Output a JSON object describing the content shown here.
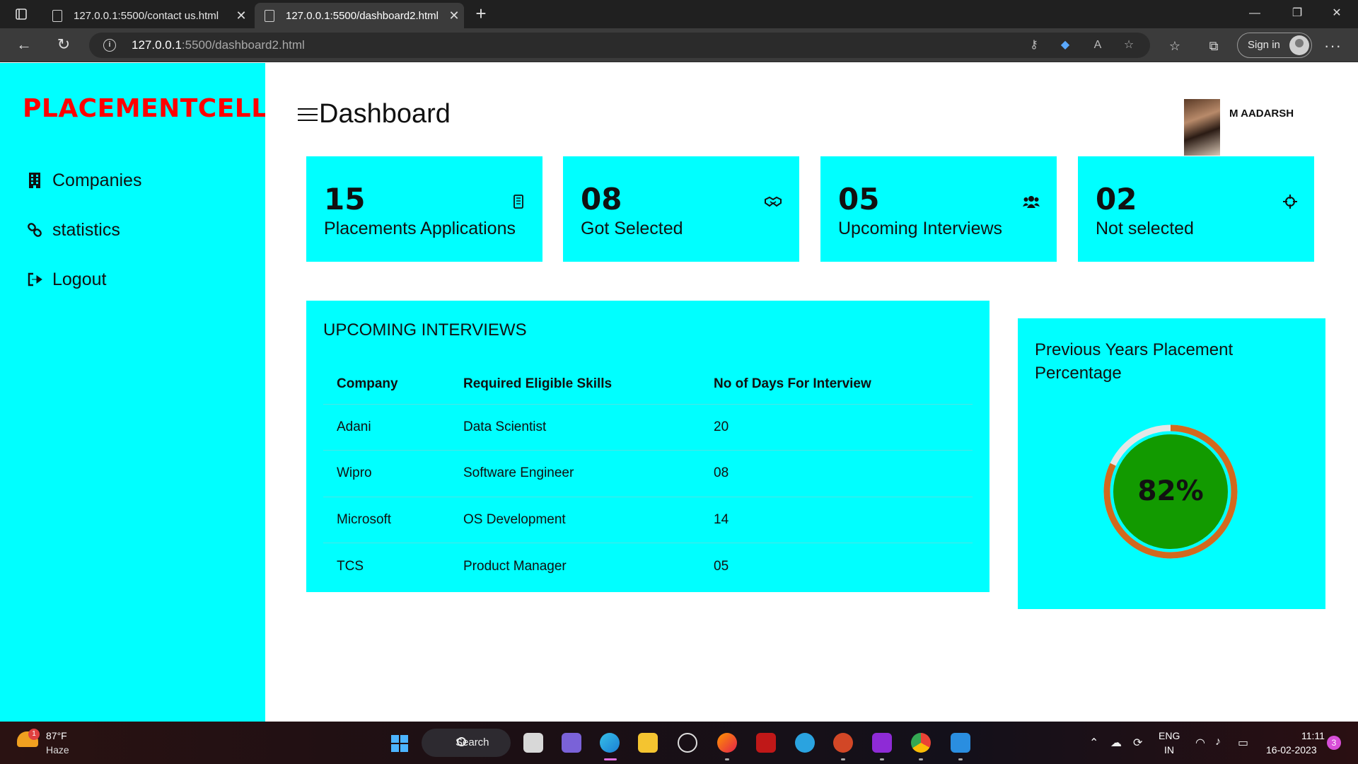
{
  "browser": {
    "tabs": [
      {
        "title": "127.0.0.1:5500/contact us.html",
        "active": false
      },
      {
        "title": "127.0.0.1:5500/dashboard2.html",
        "active": true
      }
    ],
    "url_host": "127.0.0.1",
    "url_rest": ":5500/dashboard2.html",
    "sign_in_label": "Sign in",
    "more_label": "···",
    "new_tab_label": "+",
    "minimize_label": "—",
    "restore_label": "❐",
    "close_label": "✕"
  },
  "sidebar": {
    "brand": "PLACEMENTCELL",
    "items": [
      {
        "label": "Companies",
        "icon": "building-icon"
      },
      {
        "label": "statistics",
        "icon": "link-icon"
      },
      {
        "label": "Logout",
        "icon": "logout-icon"
      }
    ]
  },
  "header": {
    "title": "Dashboard",
    "user_name": "M AADARSH"
  },
  "cards": [
    {
      "number": "15",
      "label": "Placements Applications",
      "icon": "phone-icon",
      "glyph": "▯"
    },
    {
      "number": "08",
      "label": "Got Selected",
      "icon": "handshake-icon",
      "glyph": "🤝"
    },
    {
      "number": "05",
      "label": "Upcoming Interviews",
      "icon": "users-icon",
      "glyph": "👥"
    },
    {
      "number": "02",
      "label": "Not selected",
      "icon": "crosshair-icon",
      "glyph": "⌖"
    }
  ],
  "interviews": {
    "title": "UPCOMING INTERVIEWS",
    "columns": [
      "Company",
      "Required Eligible Skills",
      "No of Days For Interview"
    ],
    "rows": [
      [
        "Adani",
        "Data Scientist",
        "20"
      ],
      [
        "Wipro",
        "Software Engineer",
        "08"
      ],
      [
        "Microsoft",
        "OS Development",
        "14"
      ],
      [
        "TCS",
        "Product Manager",
        "05"
      ]
    ]
  },
  "placement": {
    "title": "Previous Years Placement Percentage",
    "percent_label": "82%",
    "percent": 82,
    "colors": {
      "fill": "#129a00",
      "ring": "#d2691e",
      "track": "#e6e6e6"
    }
  },
  "taskbar": {
    "weather_temp": "87°F",
    "weather_desc": "Haze",
    "weather_badge": "1",
    "search_label": "Search",
    "lang_top": "ENG",
    "lang_bottom": "IN",
    "time": "11:11",
    "date": "16-02-2023",
    "notifications": "3"
  },
  "colors": {
    "accent": "#00ffff",
    "brand": "#ff0000"
  }
}
